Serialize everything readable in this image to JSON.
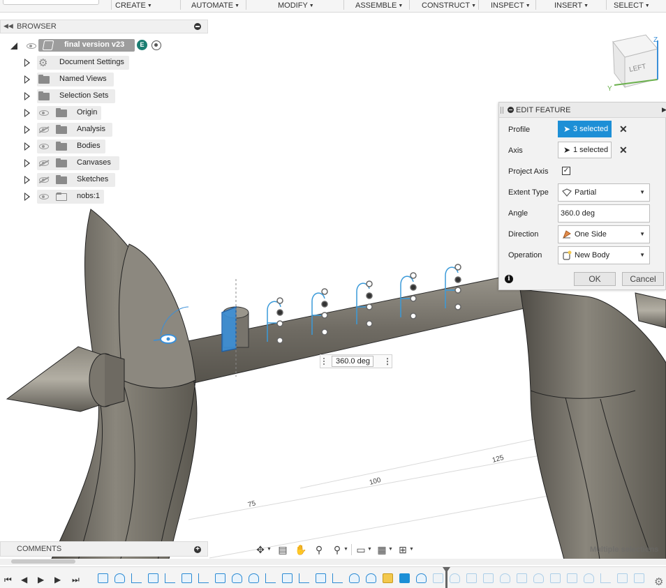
{
  "menu": {
    "items": [
      {
        "label": "CREATE"
      },
      {
        "label": "AUTOMATE"
      },
      {
        "label": "MODIFY"
      },
      {
        "label": "ASSEMBLE"
      },
      {
        "label": "CONSTRUCT"
      },
      {
        "label": "INSPECT"
      },
      {
        "label": "INSERT"
      },
      {
        "label": "SELECT"
      }
    ]
  },
  "browser": {
    "title": "BROWSER",
    "root": {
      "label": "final version v23",
      "badge": "E"
    },
    "items": [
      {
        "label": "Document Settings",
        "icon": "gear-icon"
      },
      {
        "label": "Named Views",
        "icon": "folder-icon"
      },
      {
        "label": "Selection Sets",
        "icon": "folder-icon"
      },
      {
        "label": "Origin",
        "icon": "folder-icon",
        "visibility": "visible"
      },
      {
        "label": "Analysis",
        "icon": "folder-icon",
        "visibility": "hidden"
      },
      {
        "label": "Bodies",
        "icon": "folder-icon",
        "visibility": "visible"
      },
      {
        "label": "Canvases",
        "icon": "folder-icon",
        "visibility": "hidden"
      },
      {
        "label": "Sketches",
        "icon": "folder-icon",
        "visibility": "hidden"
      },
      {
        "label": "nobs:1",
        "icon": "component-icon",
        "visibility": "visible"
      }
    ]
  },
  "viewcube": {
    "face": "LEFT",
    "axis_z": "Z",
    "axis_y": "Y"
  },
  "dialog": {
    "title": "EDIT FEATURE",
    "profile": {
      "label": "Profile",
      "value": "3 selected"
    },
    "axis": {
      "label": "Axis",
      "value": "1 selected"
    },
    "project_axis": {
      "label": "Project Axis",
      "checked": true,
      "mark": "✓"
    },
    "extent_type": {
      "label": "Extent Type",
      "value": "Partial"
    },
    "angle": {
      "label": "Angle",
      "value": "360.0 deg"
    },
    "direction": {
      "label": "Direction",
      "value": "One Side"
    },
    "operation": {
      "label": "Operation",
      "value": "New Body"
    },
    "ok_label": "OK",
    "cancel_label": "Cancel"
  },
  "canvas": {
    "angle_input": "360.0 deg",
    "ruler_labels": [
      "75",
      "100",
      "125"
    ],
    "status": "Multiple selections"
  },
  "comments": {
    "title": "COMMENTS"
  },
  "colors": {
    "accent": "#1d8fd6",
    "body_gray": "#6e6a62",
    "selection_blue": "#3a8fd8",
    "badge_teal": "#1b7e72"
  }
}
